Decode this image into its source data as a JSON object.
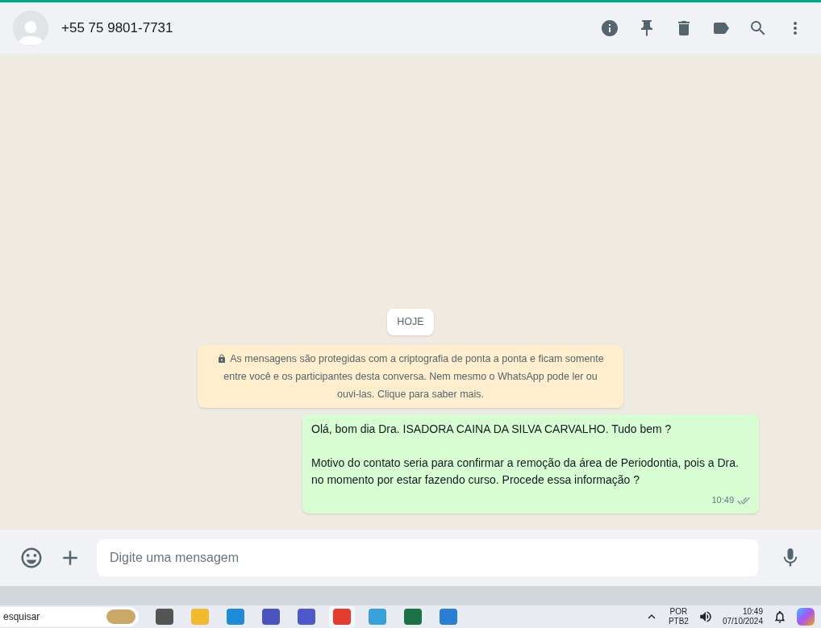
{
  "header": {
    "contact": "+55 75 9801-7731"
  },
  "chat": {
    "date_chip": "HOJE",
    "notice": "As mensagens são protegidas com a criptografia de ponta a ponta e ficam somente entre você e os participantes desta conversa. Nem mesmo o WhatsApp pode ler ou ouvi-las. Clique para saber mais.",
    "messages": [
      {
        "paragraphs": [
          "Olá, bom dia Dra. ISADORA CAINA DA SILVA CARVALHO. Tudo bem ?",
          "Motivo do contato seria para confirmar a remoção da área de Periodontia, pois a Dra. no momento por estar fazendo curso. Procede essa informação ?"
        ],
        "time": "10:49",
        "read": false
      }
    ]
  },
  "composer": {
    "placeholder": "Digite uma mensagem"
  },
  "taskbar": {
    "search": "esquisar",
    "language": "POR",
    "layout": "PTB2",
    "time": "10:49",
    "date": "07/10/2024"
  }
}
